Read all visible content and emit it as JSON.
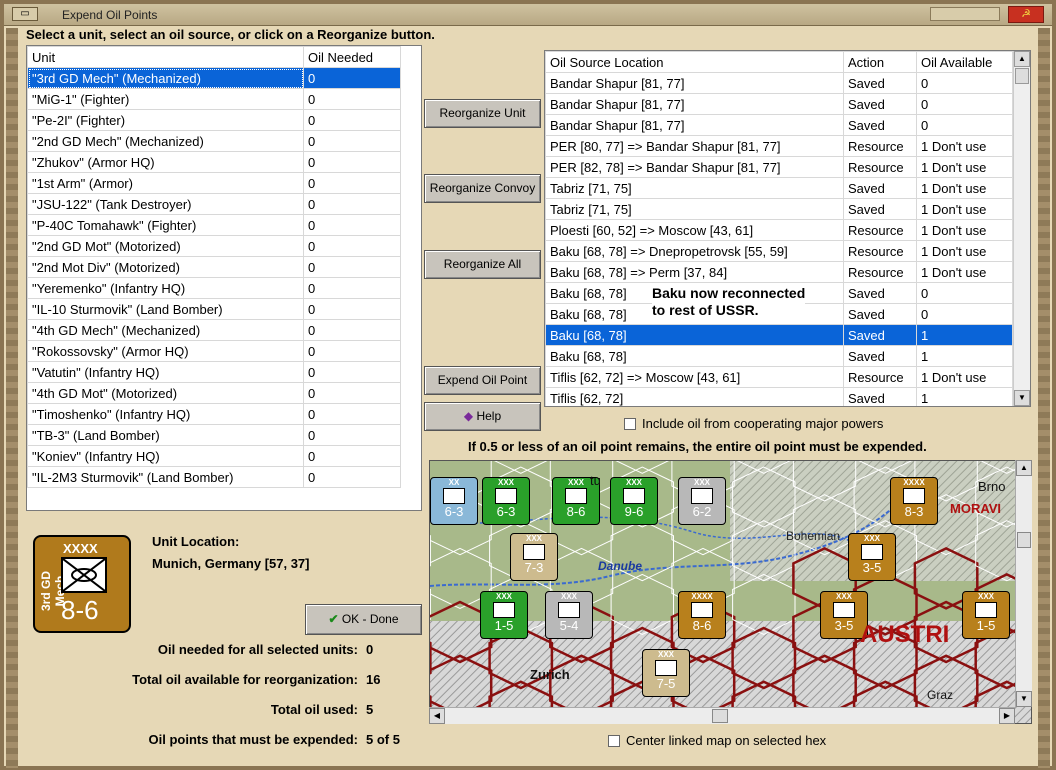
{
  "window": {
    "title": "Expend Oil Points"
  },
  "instruction": "Select a unit, select an oil source, or click on a Reorganize button.",
  "unit_table": {
    "headers": [
      "Unit",
      "Oil Needed"
    ],
    "rows": [
      {
        "unit": "\"3rd GD Mech\" (Mechanized)",
        "oil": "0",
        "selected": true
      },
      {
        "unit": "\"MiG-1\" (Fighter)",
        "oil": "0"
      },
      {
        "unit": "\"Pe-2I\" (Fighter)",
        "oil": "0"
      },
      {
        "unit": "\"2nd GD Mech\" (Mechanized)",
        "oil": "0"
      },
      {
        "unit": "\"Zhukov\" (Armor HQ)",
        "oil": "0"
      },
      {
        "unit": "\"1st Arm\" (Armor)",
        "oil": "0"
      },
      {
        "unit": "\"JSU-122\" (Tank Destroyer)",
        "oil": "0"
      },
      {
        "unit": "\"P-40C Tomahawk\" (Fighter)",
        "oil": "0"
      },
      {
        "unit": "\"2nd GD Mot\" (Motorized)",
        "oil": "0"
      },
      {
        "unit": "\"2nd Mot Div\" (Motorized)",
        "oil": "0"
      },
      {
        "unit": "\"Yeremenko\" (Infantry HQ)",
        "oil": "0"
      },
      {
        "unit": "\"IL-10 Sturmovik\" (Land Bomber)",
        "oil": "0"
      },
      {
        "unit": "\"4th GD Mech\" (Mechanized)",
        "oil": "0"
      },
      {
        "unit": "\"Rokossovsky\" (Armor HQ)",
        "oil": "0"
      },
      {
        "unit": "\"Vatutin\" (Infantry HQ)",
        "oil": "0"
      },
      {
        "unit": "\"4th GD Mot\" (Motorized)",
        "oil": "0"
      },
      {
        "unit": "\"Timoshenko\" (Infantry HQ)",
        "oil": "0"
      },
      {
        "unit": "\"TB-3\" (Land Bomber)",
        "oil": "0"
      },
      {
        "unit": "\"Koniev\" (Infantry HQ)",
        "oil": "0"
      },
      {
        "unit": "\"IL-2M3 Sturmovik\" (Land Bomber)",
        "oil": "0"
      }
    ]
  },
  "buttons": {
    "reorganize_unit": "Reorganize Unit",
    "reorganize_convoy": "Reorganize Convoy",
    "reorganize_all": "Reorganize All",
    "expend_oil_point": "Expend Oil Point",
    "help": "Help",
    "ok_done": "OK - Done"
  },
  "oil_table": {
    "headers": [
      "Oil Source Location",
      "Action",
      "Oil Available"
    ],
    "rows": [
      {
        "loc": "Bandar Shapur [81, 77]",
        "action": "Saved",
        "oil": "0"
      },
      {
        "loc": "Bandar Shapur [81, 77]",
        "action": "Saved",
        "oil": "0"
      },
      {
        "loc": "Bandar Shapur [81, 77]",
        "action": "Saved",
        "oil": "0"
      },
      {
        "loc": "PER [80, 77] => Bandar Shapur [81, 77]",
        "action": "Resource",
        "oil": "1 Don't use"
      },
      {
        "loc": "PER [82, 78] => Bandar Shapur [81, 77]",
        "action": "Resource",
        "oil": "1 Don't use"
      },
      {
        "loc": "Tabriz [71, 75]",
        "action": "Saved",
        "oil": "1 Don't use"
      },
      {
        "loc": "Tabriz [71, 75]",
        "action": "Saved",
        "oil": "1 Don't use"
      },
      {
        "loc": "Ploesti [60, 52] => Moscow [43, 61]",
        "action": "Resource",
        "oil": "1 Don't use"
      },
      {
        "loc": "Baku [68, 78] => Dnepropetrovsk [55, 59]",
        "action": "Resource",
        "oil": "1 Don't use"
      },
      {
        "loc": "Baku [68, 78] => Perm [37, 84]",
        "action": "Resource",
        "oil": "1 Don't use"
      },
      {
        "loc": "Baku [68, 78]",
        "action": "Saved",
        "oil": "0"
      },
      {
        "loc": "Baku [68, 78]",
        "action": "Saved",
        "oil": "0"
      },
      {
        "loc": "Baku [68, 78]",
        "action": "Saved",
        "oil": "1",
        "selected": true
      },
      {
        "loc": "Baku [68, 78]",
        "action": "Saved",
        "oil": "1"
      },
      {
        "loc": "Tiflis [62, 72] => Moscow [43, 61]",
        "action": "Resource",
        "oil": "1 Don't use"
      },
      {
        "loc": "Tiflis [62, 72]",
        "action": "Saved",
        "oil": "1"
      }
    ]
  },
  "annotation": [
    "Baku now reconnected",
    "to rest of USSR."
  ],
  "include_cooperating": "Include oil from cooperating major powers",
  "oil_rule": "If 0.5 or less of an oil point remains, the entire oil point must be expended.",
  "selected_unit": {
    "hq_size": "XXXX",
    "name": "3rd GD Mech",
    "strength": "8-6",
    "location_label": "Unit Location:",
    "location": "Munich, Germany [57, 37]"
  },
  "stats": {
    "needed_label": "Oil needed for all selected units:",
    "needed_value": "0",
    "available_label": "Total oil available for reorganization:",
    "available_value": "16",
    "used_label": "Total oil used:",
    "used_value": "5",
    "must_label": "Oil points that must be expended:",
    "must_value": "5 of 5"
  },
  "map": {
    "labels": {
      "danube": "Danube",
      "bohemian": "Bohemian",
      "zurich": "Zurich",
      "austria": "AUSTRI",
      "moravia": "MORAVI",
      "brno": "Brno",
      "graz": "Graz",
      "stuttgart": "tu"
    },
    "counters": [
      {
        "label": "6-3",
        "size": "XXX",
        "color": "#2aa02a"
      },
      {
        "label": "8-6",
        "size": "XXX",
        "color": "#2aa02a"
      },
      {
        "label": "9-6",
        "size": "XXX",
        "color": "#2aa02a"
      },
      {
        "label": "6-2",
        "size": "XXX",
        "color": "#b8b8b8"
      },
      {
        "label": "8-3",
        "size": "XXXX",
        "color": "#b8801c"
      },
      {
        "label": "7-3",
        "size": "XXX",
        "color": "#cdbb8e"
      },
      {
        "label": "3-5",
        "size": "XXX",
        "color": "#b8801c"
      },
      {
        "label": "1-5",
        "size": "XXX",
        "color": "#2aa02a"
      },
      {
        "label": "5-4",
        "size": "XXX",
        "color": "#b8b8b8"
      },
      {
        "label": "8-6",
        "size": "XXXX",
        "color": "#b8801c"
      },
      {
        "label": "3-5",
        "size": "XXX",
        "color": "#b8801c"
      },
      {
        "label": "1-5",
        "size": "XXX",
        "color": "#b8801c"
      },
      {
        "label": "7-5",
        "size": "XXX",
        "color": "#cdbb8e"
      },
      {
        "label": "6-3",
        "size": "XX",
        "color": "#8ab8d8"
      }
    ]
  },
  "center_map": "Center linked map on selected hex"
}
